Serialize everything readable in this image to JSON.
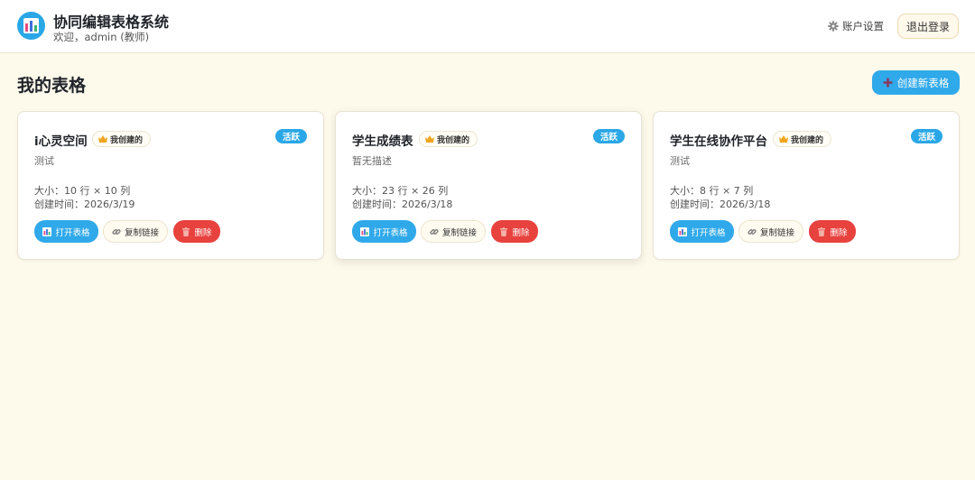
{
  "header": {
    "title": "协同编辑表格系统",
    "welcome": "欢迎，admin (教师)",
    "settings_label": "账户设置",
    "logout_label": "退出登录"
  },
  "main": {
    "page_title": "我的表格",
    "create_label": "创建新表格"
  },
  "cards": [
    {
      "title": "i心灵空间",
      "owner_badge": "我创建的",
      "status": "活跃",
      "description": "测试",
      "size": "大小：10 行 × 10 列",
      "created": "创建时间：2026/3/19",
      "open_label": "打开表格",
      "copy_label": "复制链接",
      "delete_label": "删除"
    },
    {
      "title": "学生成绩表",
      "owner_badge": "我创建的",
      "status": "活跃",
      "description": "暂无描述",
      "size": "大小：23 行 × 26 列",
      "created": "创建时间：2026/3/18",
      "open_label": "打开表格",
      "copy_label": "复制链接",
      "delete_label": "删除"
    },
    {
      "title": "学生在线协作平台",
      "owner_badge": "我创建的",
      "status": "活跃",
      "description": "测试",
      "size": "大小：8 行 × 7 列",
      "created": "创建时间：2026/3/18",
      "open_label": "打开表格",
      "copy_label": "复制链接",
      "delete_label": "删除"
    }
  ],
  "colors": {
    "accent": "#30a9ea",
    "danger": "#e8423f",
    "background": "#fdf9eb"
  },
  "icons": {
    "logo": "bar-chart-logo-icon",
    "settings": "gear-icon",
    "create": "plus-icon",
    "owner": "crown-icon",
    "open": "chart-icon",
    "copy": "link-icon",
    "delete": "trash-icon"
  }
}
